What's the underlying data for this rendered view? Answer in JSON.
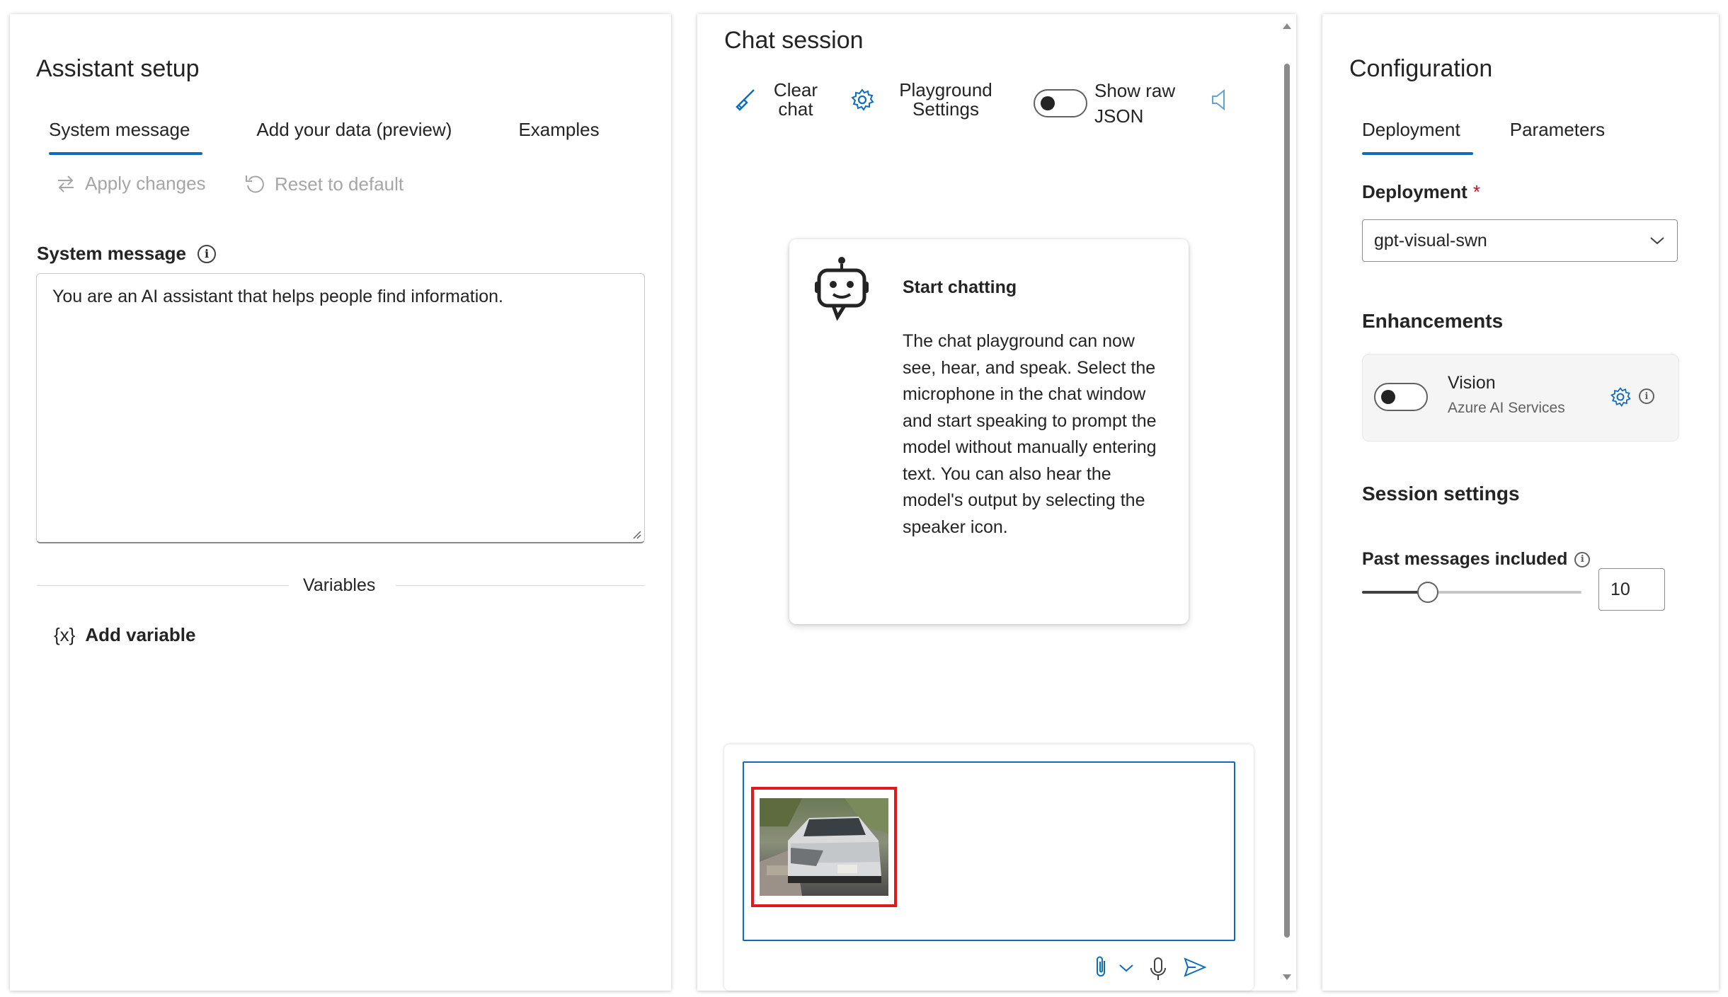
{
  "assistant_setup": {
    "title": "Assistant setup",
    "tabs": [
      {
        "label": "System message",
        "active": true
      },
      {
        "label": "Add your data (preview)",
        "active": false
      },
      {
        "label": "Examples",
        "active": false
      }
    ],
    "apply_label": "Apply changes",
    "reset_label": "Reset to default",
    "system_message_label": "System message",
    "system_message_value": "You are an AI assistant that helps people find information.",
    "variables_label": "Variables",
    "add_variable_glyph": "{x}",
    "add_variable_label": "Add variable"
  },
  "chat_session": {
    "title": "Chat session",
    "clear_chat_label": "Clear chat",
    "playground_settings_label": "Playground Settings",
    "show_raw_json_label": "Show raw JSON",
    "show_raw_json_on": false,
    "start_card": {
      "title": "Start chatting",
      "body": "The chat playground can now see, hear, and speak. Select the microphone in the chat window and start speaking to prompt the model without manually entering text. You can also hear the model's output by selecting the speaker icon."
    },
    "attachment": {
      "kind": "image",
      "description": "damaged car photo thumbnail",
      "highlight_color": "#e0181f"
    }
  },
  "configuration": {
    "title": "Configuration",
    "tabs": [
      {
        "label": "Deployment",
        "active": true
      },
      {
        "label": "Parameters",
        "active": false
      }
    ],
    "deployment_label": "Deployment",
    "required_mark": "*",
    "deployment_value": "gpt-visual-swn",
    "enhancements_title": "Enhancements",
    "vision_label": "Vision",
    "vision_subtitle": "Azure AI Services",
    "vision_on": false,
    "session_settings_title": "Session settings",
    "past_messages_label": "Past messages included",
    "past_messages_value": "10",
    "past_messages_slider_fraction": 0.3
  },
  "colors": {
    "accent": "#0f6cbd",
    "disabled_text": "#a6a6a6",
    "required": "#c50f1f"
  }
}
